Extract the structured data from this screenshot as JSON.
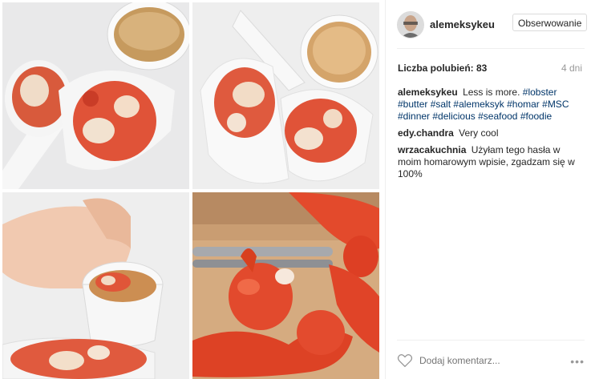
{
  "post": {
    "author": "alemeksykeu",
    "follow_label": "Obserwowanie",
    "likes_text": "Liczba polubień: 83",
    "time": "4 dni",
    "photos": [
      "lobster-spoon-platter",
      "lobster-spoons-with-soup",
      "hand-dipping-lobster",
      "cooked-lobster-with-cracker"
    ]
  },
  "comments": [
    {
      "user": "alemeksykeu",
      "text": "Less is more.",
      "tags": [
        "#lobster",
        "#butter",
        "#salt",
        "#alemeksyk",
        "#homar",
        "#MSC",
        "#dinner",
        "#delicious",
        "#seafood",
        "#foodie"
      ]
    },
    {
      "user": "edy.chandra",
      "text": "Very cool"
    },
    {
      "user": "wrzacakuchnia",
      "text": "Użyłam tego hasła w moim homarowym wpisie, zgadzam się w 100%"
    }
  ],
  "footer": {
    "comment_placeholder": "Dodaj komentarz...",
    "more_label": "•••"
  },
  "colors": {
    "text": "#262626",
    "hashtag": "#003569",
    "muted": "#999999",
    "border": "#dbdbdb"
  }
}
